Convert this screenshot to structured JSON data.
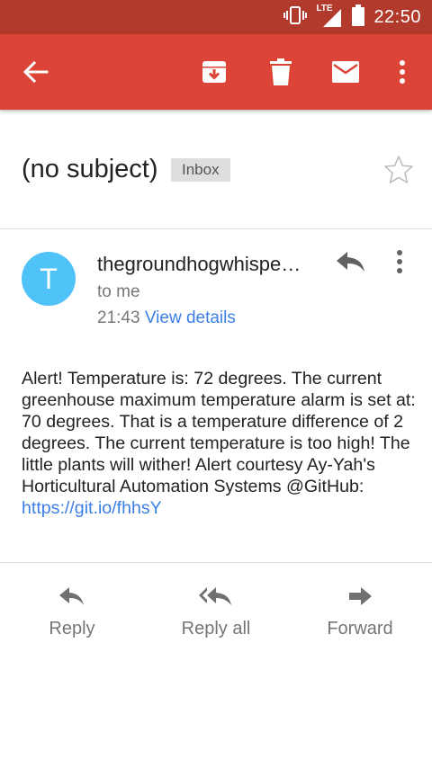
{
  "status_bar": {
    "network": "LTE",
    "time": "22:50"
  },
  "toolbar": {
    "back_icon": "arrow-back-icon",
    "archive_icon": "archive-icon",
    "delete_icon": "delete-icon",
    "mark_unread_icon": "mail-icon",
    "more_icon": "more-vert-icon"
  },
  "email": {
    "subject": "(no subject)",
    "label": "Inbox",
    "sender_initial": "T",
    "sender": "thegroundhogwhispe…",
    "recipient": "to me",
    "time": "21:43",
    "view_details": "View details",
    "body": "Alert! Temperature is: 72 degrees. The current greenhouse maximum temperature alarm is set at: 70 degrees. That is a temperature difference of 2 degrees. The current temperature is too high! The little plants will wither! Alert courtesy Ay-Yah's Horticultural Automation Systems @GitHub:",
    "body_link": "https://git.io/fhhsY"
  },
  "actions": {
    "reply": "Reply",
    "reply_all": "Reply all",
    "forward": "Forward"
  },
  "colors": {
    "status_bar": "#b23a2c",
    "toolbar": "#db4437",
    "avatar": "#4fc3f7",
    "link": "#3b7fe6"
  }
}
